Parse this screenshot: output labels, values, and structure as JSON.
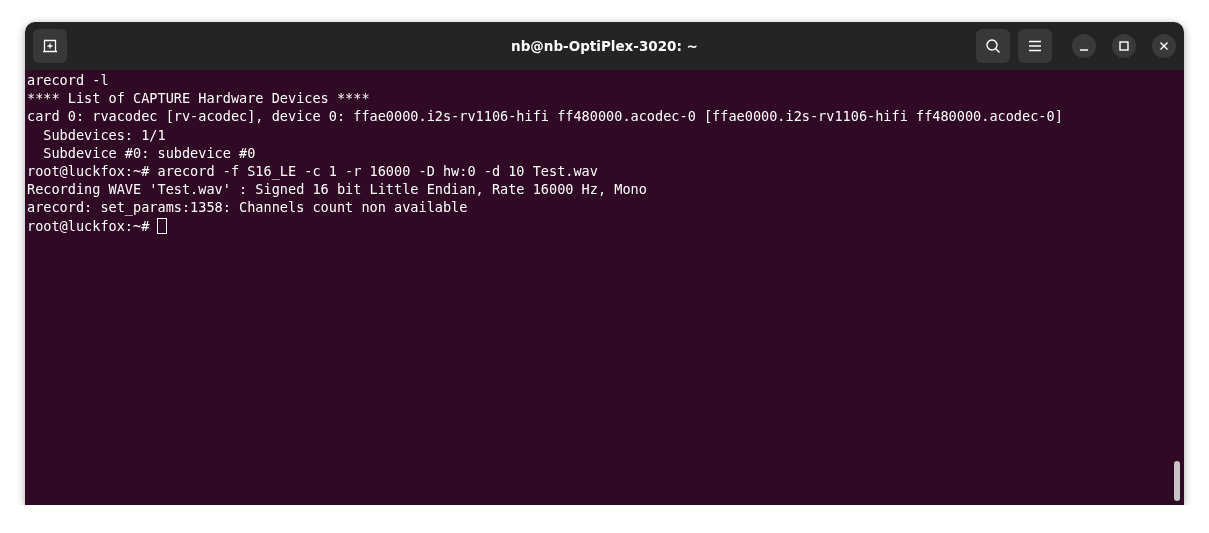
{
  "window": {
    "title": "nb@nb-OptiPlex-3020: ~"
  },
  "terminal": {
    "lines": [
      "arecord -l",
      "**** List of CAPTURE Hardware Devices ****",
      "card 0: rvacodec [rv-acodec], device 0: ffae0000.i2s-rv1106-hifi ff480000.acodec-0 [ffae0000.i2s-rv1106-hifi ff480000.acodec-0]",
      "  Subdevices: 1/1",
      "  Subdevice #0: subdevice #0",
      "root@luckfox:~# arecord -f S16_LE -c 1 -r 16000 -D hw:0 -d 10 Test.wav",
      "Recording WAVE 'Test.wav' : Signed 16 bit Little Endian, Rate 16000 Hz, Mono",
      "arecord: set_params:1358: Channels count non available",
      "root@luckfox:~#"
    ],
    "cursor": true
  }
}
